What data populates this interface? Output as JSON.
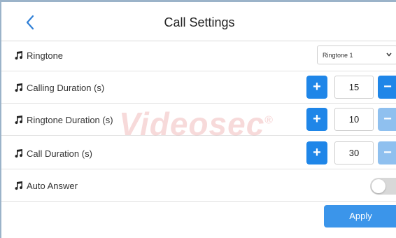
{
  "header": {
    "title": "Call Settings",
    "back_icon": "chevron-left-icon"
  },
  "settings": {
    "ringtone": {
      "label": "Ringtone",
      "selected": "Ringtone 1"
    },
    "calling_duration": {
      "label": "Calling Duration (s)",
      "value": "15"
    },
    "ringtone_duration": {
      "label": "Ringtone Duration (s)",
      "value": "10"
    },
    "call_duration": {
      "label": "Call Duration (s)",
      "value": "30"
    },
    "auto_answer": {
      "label": "Auto Answer",
      "enabled": false
    }
  },
  "buttons": {
    "plus": "+",
    "minus": "−",
    "apply": "Apply"
  },
  "watermark": {
    "text": "Videosec",
    "mark": "®"
  },
  "colors": {
    "accent": "#1f86e8",
    "accent_light": "#8fc0ef",
    "apply": "#3b95ea",
    "toggle_off": "#d8d8d8"
  }
}
